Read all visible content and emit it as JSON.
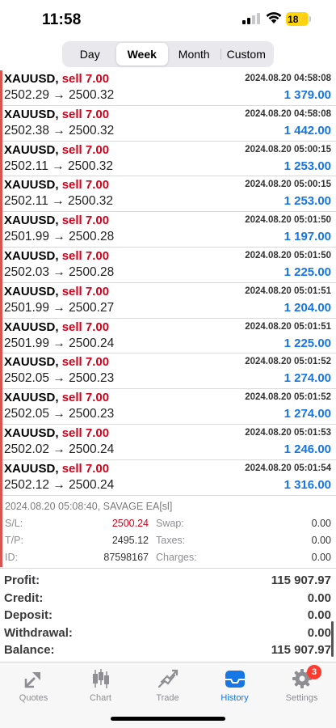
{
  "status": {
    "time": "11:58",
    "battery": "18"
  },
  "periods": {
    "day": "Day",
    "week": "Week",
    "month": "Month",
    "custom": "Custom",
    "active": "Week"
  },
  "deals": [
    {
      "symbol": "XAUUSD",
      "side": "sell 7.00",
      "open": "2502.29",
      "close": "2500.32",
      "datetime": "2024.08.20 04:58:08",
      "profit": "1 379.00"
    },
    {
      "symbol": "XAUUSD",
      "side": "sell 7.00",
      "open": "2502.38",
      "close": "2500.32",
      "datetime": "2024.08.20 04:58:08",
      "profit": "1 442.00"
    },
    {
      "symbol": "XAUUSD",
      "side": "sell 7.00",
      "open": "2502.11",
      "close": "2500.32",
      "datetime": "2024.08.20 05:00:15",
      "profit": "1 253.00"
    },
    {
      "symbol": "XAUUSD",
      "side": "sell 7.00",
      "open": "2502.11",
      "close": "2500.32",
      "datetime": "2024.08.20 05:00:15",
      "profit": "1 253.00"
    },
    {
      "symbol": "XAUUSD",
      "side": "sell 7.00",
      "open": "2501.99",
      "close": "2500.28",
      "datetime": "2024.08.20 05:01:50",
      "profit": "1 197.00"
    },
    {
      "symbol": "XAUUSD",
      "side": "sell 7.00",
      "open": "2502.03",
      "close": "2500.28",
      "datetime": "2024.08.20 05:01:50",
      "profit": "1 225.00"
    },
    {
      "symbol": "XAUUSD",
      "side": "sell 7.00",
      "open": "2501.99",
      "close": "2500.27",
      "datetime": "2024.08.20 05:01:51",
      "profit": "1 204.00"
    },
    {
      "symbol": "XAUUSD",
      "side": "sell 7.00",
      "open": "2501.99",
      "close": "2500.24",
      "datetime": "2024.08.20 05:01:51",
      "profit": "1 225.00"
    },
    {
      "symbol": "XAUUSD",
      "side": "sell 7.00",
      "open": "2502.05",
      "close": "2500.23",
      "datetime": "2024.08.20 05:01:52",
      "profit": "1 274.00"
    },
    {
      "symbol": "XAUUSD",
      "side": "sell 7.00",
      "open": "2502.05",
      "close": "2500.23",
      "datetime": "2024.08.20 05:01:52",
      "profit": "1 274.00"
    },
    {
      "symbol": "XAUUSD",
      "side": "sell 7.00",
      "open": "2502.02",
      "close": "2500.24",
      "datetime": "2024.08.20 05:01:53",
      "profit": "1 246.00"
    },
    {
      "symbol": "XAUUSD",
      "side": "sell 7.00",
      "open": "2502.12",
      "close": "2500.24",
      "datetime": "2024.08.20 05:01:54",
      "profit": "1 316.00"
    }
  ],
  "detail": {
    "header": "2024.08.20 05:08:40, SAVAGE EA[sl]",
    "sl_label": "S/L:",
    "sl_value": "2500.24",
    "tp_label": "T/P:",
    "tp_value": "2495.12",
    "id_label": "ID:",
    "id_value": "87598167",
    "swap_label": "Swap:",
    "swap_value": "0.00",
    "taxes_label": "Taxes:",
    "taxes_value": "0.00",
    "charges_label": "Charges:",
    "charges_value": "0.00"
  },
  "summary": [
    {
      "label": "Profit:",
      "value": "115 907.97"
    },
    {
      "label": "Credit:",
      "value": "0.00"
    },
    {
      "label": "Deposit:",
      "value": "0.00"
    },
    {
      "label": "Withdrawal:",
      "value": "0.00"
    },
    {
      "label": "Balance:",
      "value": "115 907.97"
    }
  ],
  "tabs": [
    {
      "label": "Quotes",
      "icon": "quotes-icon"
    },
    {
      "label": "Chart",
      "icon": "candlestick-icon"
    },
    {
      "label": "Trade",
      "icon": "trade-icon"
    },
    {
      "label": "History",
      "icon": "history-tray-icon",
      "active": true
    },
    {
      "label": "Settings",
      "icon": "gear-icon",
      "badge": "3"
    }
  ],
  "colors": {
    "accent": "#1676e5",
    "sell": "#d0021b",
    "indicator": "#d9534f"
  }
}
